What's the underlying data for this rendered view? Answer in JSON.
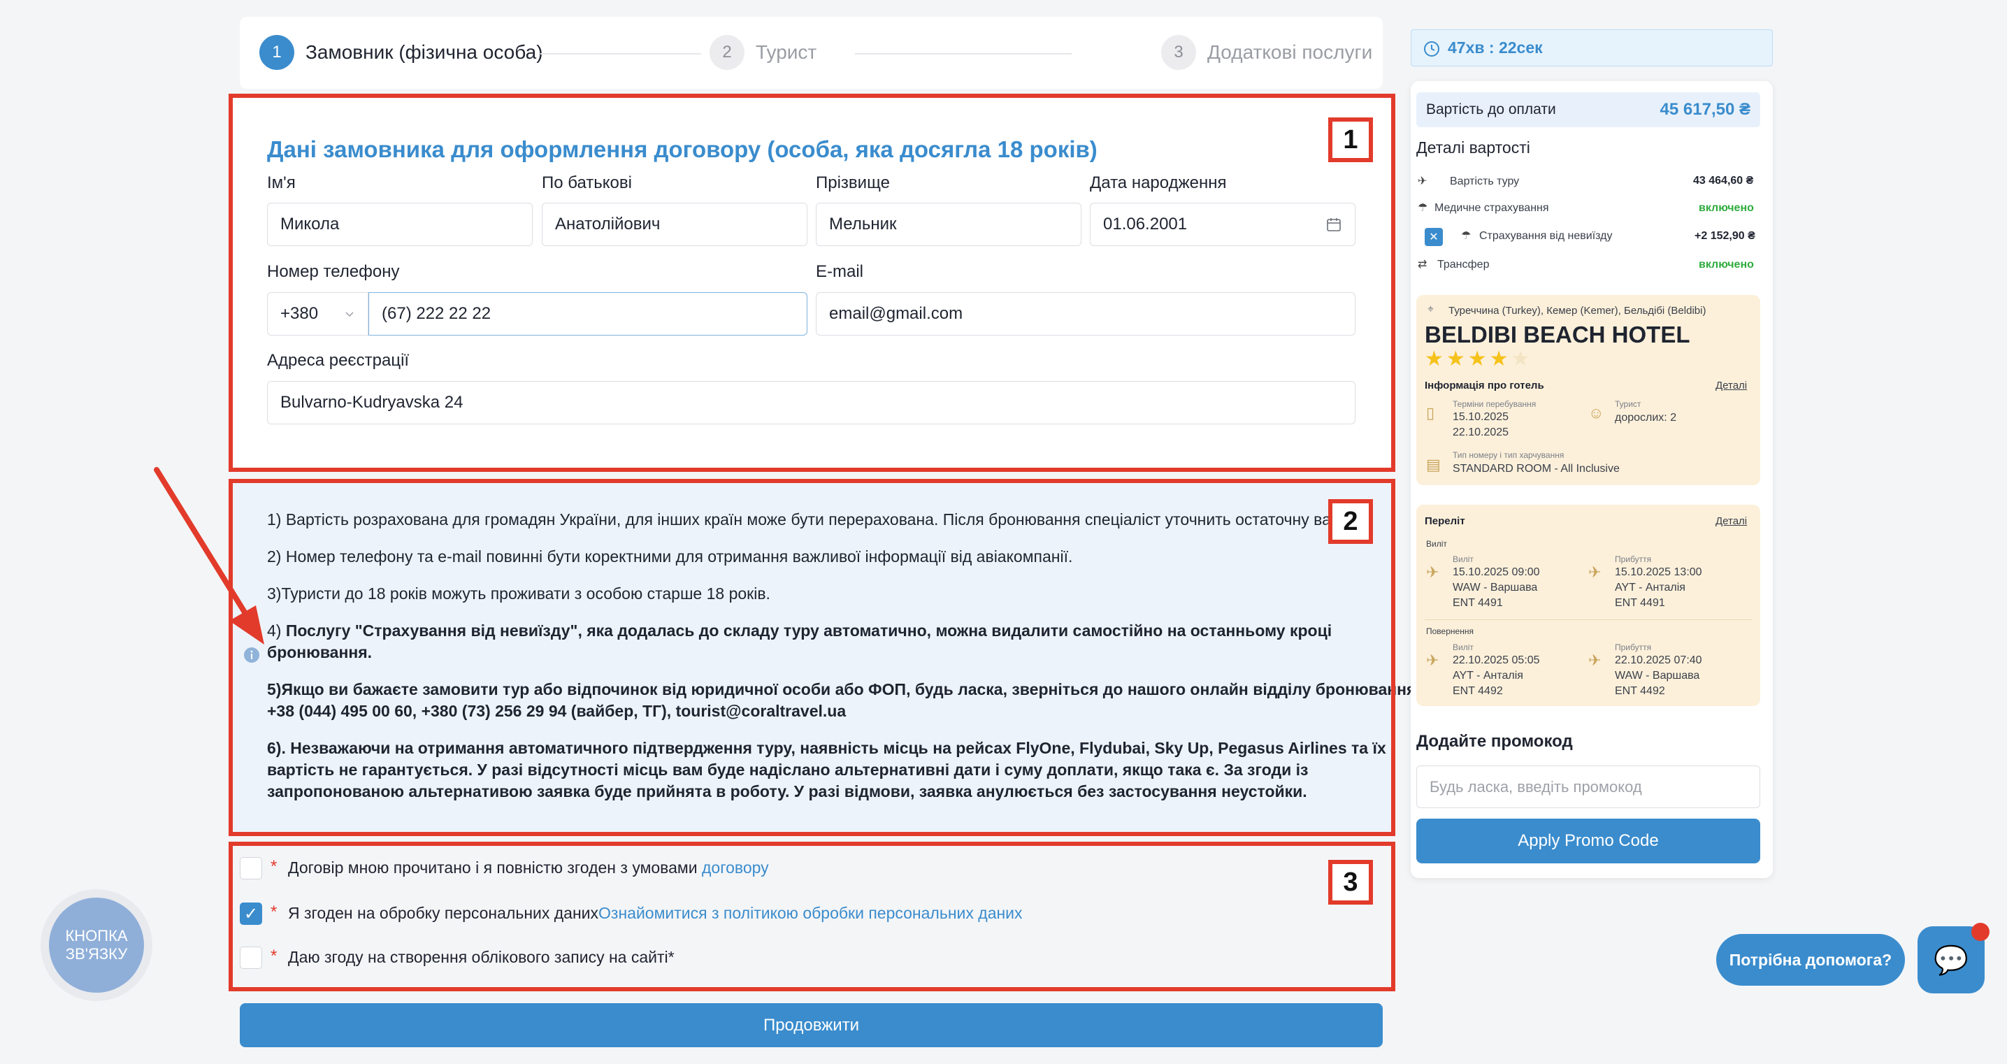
{
  "stepper": {
    "steps": [
      {
        "num": "1",
        "label": "Замовник (фізична особа)"
      },
      {
        "num": "2",
        "label": "Турист"
      },
      {
        "num": "3",
        "label": "Додаткові послуги"
      }
    ]
  },
  "annotations": {
    "one": "1",
    "two": "2",
    "three": "3"
  },
  "customer": {
    "title": "Дані замовника для оформлення договору (особа, яка досягла 18 років)",
    "first_name_label": "Ім'я",
    "first_name": "Микола",
    "patronymic_label": "По батькові",
    "patronymic": "Анатолійович",
    "last_name_label": "Прізвище",
    "last_name": "Мельник",
    "dob_label": "Дата народження",
    "dob": "01.06.2001",
    "phone_label": "Номер телефону",
    "phone_code": "+380",
    "phone": "(67) 222 22 22",
    "email_label": "E-mail",
    "email": "email@gmail.com",
    "address_label": "Адреса реєстрації",
    "address": "Bulvarno-Kudryavska 24"
  },
  "notes": {
    "n1": "1) Вартість розрахована для громадян України, для інших країн може бути перерахована. Після бронювання спеціаліст уточнить остаточну вар",
    "n2": "2) Номер телефону та e-mail повинні бути коректними для отримання важливої інформації від авіакомпанії.",
    "n3": "3)Туристи до 18 років можуть проживати з особою старше 18 років.",
    "n4_prefix": "4) ",
    "n4_a": "Послугу \"Страхування від невиїзду\", яка додалась до складу туру автоматично, можна видалити самостійно на останньому кроці",
    "n4_b": "бронювання.",
    "n5_a": "5)Якщо ви бажаєте замовити тур або відпочинок від юридичної особи або ФОП, будь ласка, зверніться до нашого онлайн відділу бронювання:",
    "n5_b": "+38 (044) 495 00 60, +380 (73) 256 29 94 (вайбер, ТГ), tourist@coraltravel.ua",
    "n6_a": "6). Незважаючи на отримання автоматичного підтвердження туру, наявність місць на рейсах FlyOne, Flydubai, Sky Up, Pegasus Airlines та їх",
    "n6_b": "вартість не гарантується. У разі відсутності місць вам буде надіслано альтернативні дати і суму доплати, якщо така є. За згоди із",
    "n6_c": "запропонованою альтернативою заявка буде прийнята в роботу. У разі відмови, заявка анулюється без застосування неустойки."
  },
  "consents": {
    "c1_text": "Договір мною прочитано і я повністю згоден з умовами ",
    "c1_link": "договору",
    "c2_text": "Я згоден на обробку персональних даних",
    "c2_link": "Ознайомитися з політикою обробки персональних даних",
    "c3_text": "Даю згоду на створення облікового запису на сайті*",
    "required_mark": "*",
    "checked_mark": "✓"
  },
  "continue_label": "Продовжити",
  "timer": "47хв : 22сек",
  "summary": {
    "pay_label": "Вартість до оплати",
    "pay_value": "45 617,50 ₴",
    "details_title": "Деталі вартості",
    "tour_label": "Вартість туру",
    "tour_value": "43 464,60 ₴",
    "med_label": "Медичне страхування",
    "med_value": "включено",
    "cancel_label": "Страхування від невиїзду",
    "cancel_value": "+2 152,90 ₴",
    "transfer_label": "Трансфер",
    "transfer_value": "включено",
    "cancel_checkbox": "✕"
  },
  "hotel": {
    "location": "Туреччина (Turkey), Кемер (Kemer), Бельдібі (Beldibi)",
    "name": "BELDIBI BEACH HOTEL",
    "stars": "★★★★",
    "star_empty": "★",
    "info_label": "Інформація про готель",
    "details_link": "Деталі",
    "stay_label": "Терміни перебування",
    "stay_from": "15.10.2025",
    "stay_to": "22.10.2025",
    "tourist_label": "Турист",
    "tourist_value": "дорослих: 2",
    "room_label": "Тип номеру і тип харчування",
    "room_value": "STANDARD ROOM - All Inclusive"
  },
  "flight": {
    "title": "Переліт",
    "details_link": "Деталі",
    "out_label": "Виліт",
    "depart_label": "Виліт",
    "arrive_label": "Прибуття",
    "out_dep_time": "15.10.2025 09:00",
    "out_dep_route": "WAW - Варшава",
    "out_dep_no": "ENT 4491",
    "out_arr_time": "15.10.2025 13:00",
    "out_arr_route": "AYT - Анталія",
    "out_arr_no": "ENT 4491",
    "return_label": "Повернення",
    "ret_dep_time": "22.10.2025 05:05",
    "ret_dep_route": "AYT - Анталія",
    "ret_dep_no": "ENT 4492",
    "ret_arr_time": "22.10.2025 07:40",
    "ret_arr_route": "WAW - Варшава",
    "ret_arr_no": "ENT 4492"
  },
  "promo": {
    "title": "Додайте промокод",
    "placeholder": "Будь ласка, введіть промокод",
    "button": "Apply Promo Code"
  },
  "contact_button": "КНОПКА ЗВ'ЯЗКУ",
  "help_bubble": "Потрібна допомога?",
  "chat_icon": "💬"
}
